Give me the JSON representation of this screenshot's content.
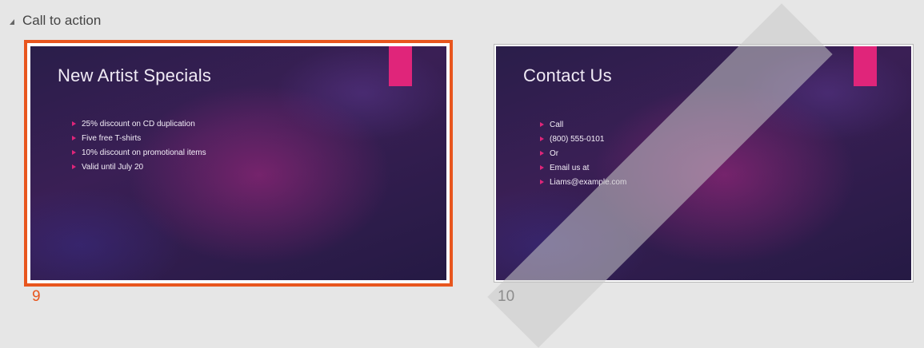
{
  "section": {
    "title": "Call to action",
    "collapse_icon": "collapse-triangle-icon"
  },
  "slides": [
    {
      "number": "9",
      "title": "New Artist Specials",
      "bullets": [
        "25% discount on CD duplication",
        "Five free T-shirts",
        "10% discount on promotional items",
        "Valid until July 20"
      ],
      "selected": true
    },
    {
      "number": "10",
      "title": "Contact Us",
      "bullets": [
        "Call",
        "(800) 555-0101",
        "Or",
        "Email us at",
        "Liams@example.com"
      ],
      "selected": false
    }
  ],
  "colors": {
    "selection": "#e8561e",
    "accent": "#e0257a",
    "background": "#e6e6e6"
  }
}
